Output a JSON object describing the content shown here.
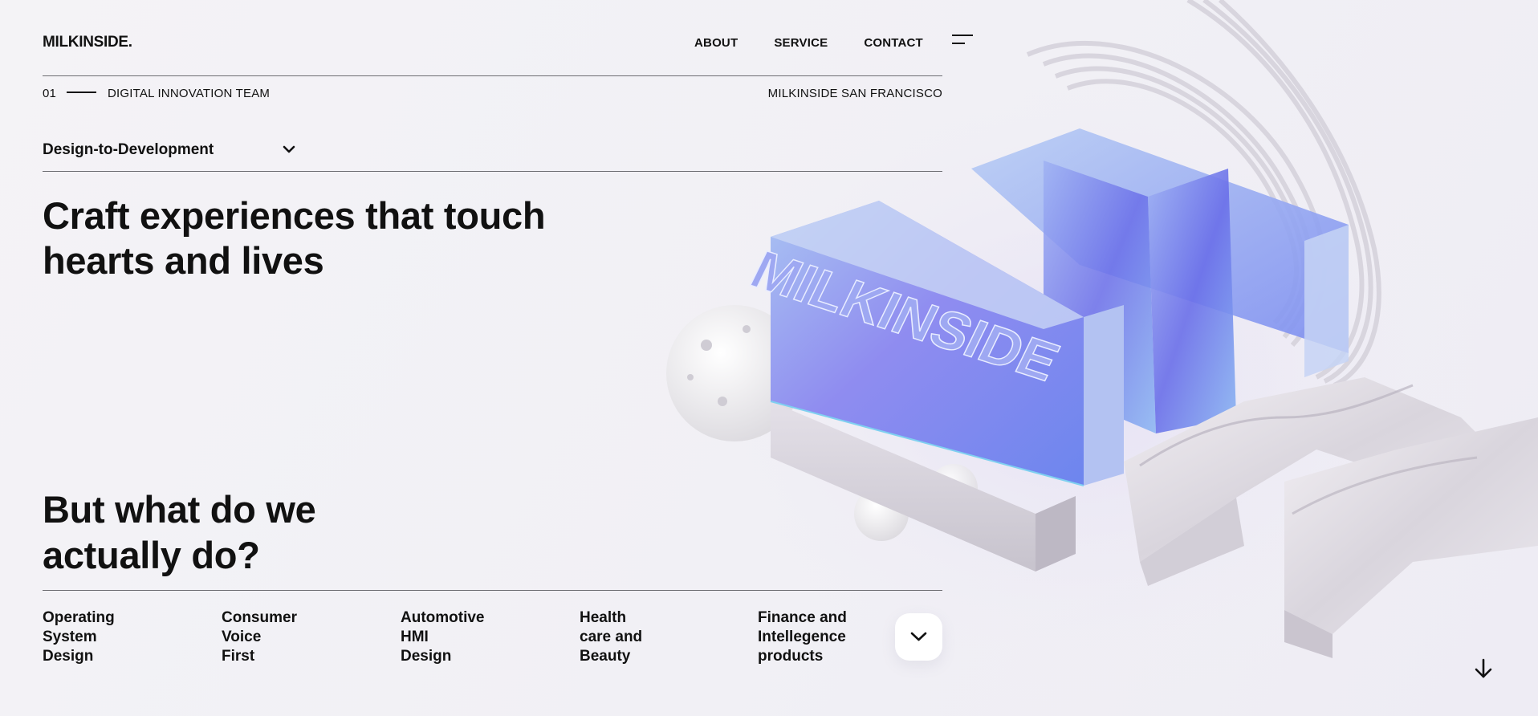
{
  "brand": {
    "logo": "MILKINSIDE."
  },
  "nav": {
    "items": [
      "ABOUT",
      "SERVICE",
      "CONTACT"
    ]
  },
  "meta": {
    "number": "01",
    "team": "DIGITAL INNOVATION TEAM",
    "city": "MILKINSIDE SAN FRANCISCO"
  },
  "dropdown": {
    "selected": "Design-to-Development"
  },
  "hero": {
    "line1": "Craft experiences that touch",
    "line2": "hearts and lives"
  },
  "question": {
    "line1": "But what do we",
    "line2": "actually do?"
  },
  "categories": [
    {
      "lines": [
        "Operating",
        "System",
        "Design"
      ]
    },
    {
      "lines": [
        "Consumer",
        "Voice",
        "First"
      ]
    },
    {
      "lines": [
        "Automotive",
        "HMI",
        "Design"
      ]
    },
    {
      "lines": [
        "Health",
        "care and",
        "Beauty"
      ]
    },
    {
      "lines": [
        "Finance and",
        "Intellegence",
        "products"
      ]
    }
  ],
  "artwork": {
    "engraving": "MILKINSIDE"
  },
  "icons": {
    "menu": "menu-icon",
    "dropdown": "chevron-down-icon",
    "more": "chevron-down-icon",
    "scroll": "arrow-down-icon"
  },
  "colors": {
    "text": "#111111",
    "background": "#f3f2f6",
    "accent_blue": "#6a78f0"
  }
}
